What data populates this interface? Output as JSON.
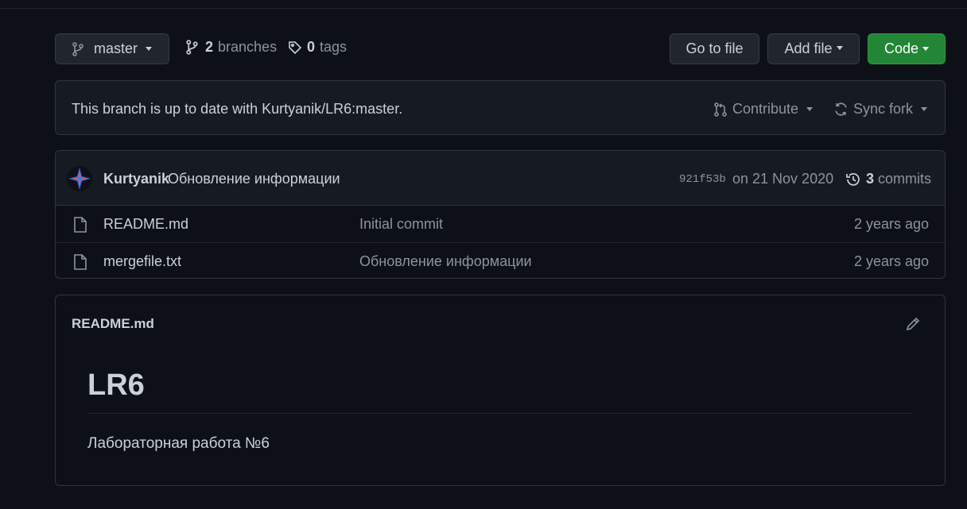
{
  "repo_bar": {
    "branch_name": "master",
    "branches_count": "2",
    "branches_label": "branches",
    "tags_count": "0",
    "tags_label": "tags",
    "go_to_file": "Go to file",
    "add_file": "Add file",
    "code": "Code"
  },
  "status": {
    "message": "This branch is up to date with Kurtyanik/LR6:master.",
    "contribute": "Contribute",
    "sync_fork": "Sync fork"
  },
  "commit": {
    "author": "Kurtyanik",
    "message": "Обновление информации",
    "sha": "921f53b",
    "date": "on 21 Nov 2020",
    "commits_count": "3",
    "commits_label": "commits"
  },
  "files": [
    {
      "name": "README.md",
      "message": "Initial commit",
      "age": "2 years ago"
    },
    {
      "name": "mergefile.txt",
      "message": "Обновление информации",
      "age": "2 years ago"
    }
  ],
  "readme": {
    "title": "README.md",
    "heading": "LR6",
    "paragraph": "Лабораторная работа №6"
  },
  "colors": {
    "background": "#0d1117",
    "panel": "#161b22",
    "border": "#30363d",
    "text": "#c9d1d9",
    "muted": "#8b949e",
    "code_button": "#238636"
  }
}
